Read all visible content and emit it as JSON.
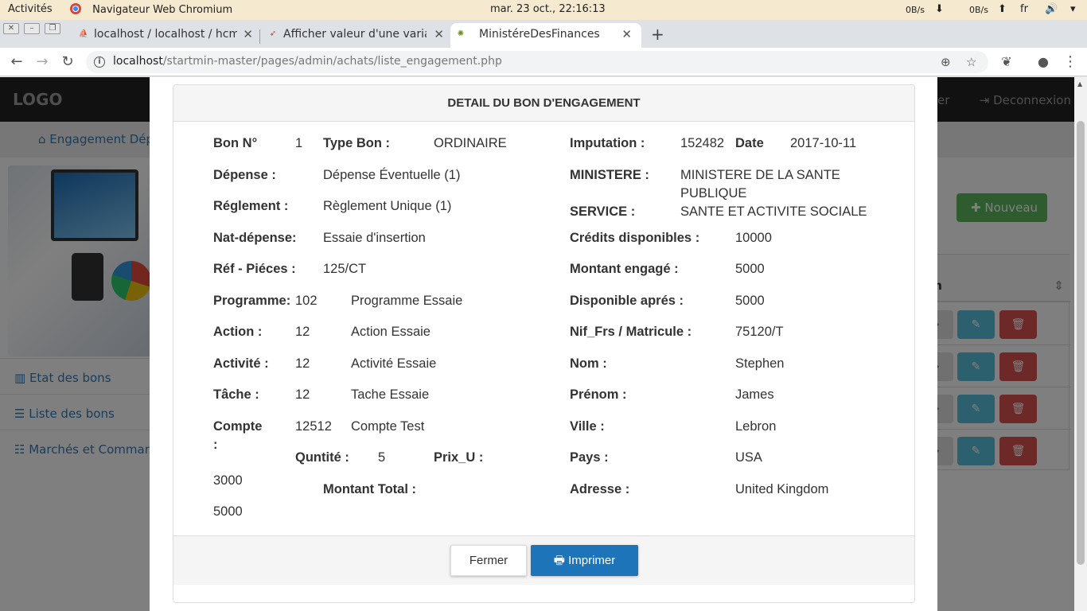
{
  "system_bar": {
    "activities": "Activités",
    "app_name": "Navigateur Web Chromium",
    "datetime": "mar. 23 oct., 22:16:13",
    "net_down": "0B/s",
    "net_up": "0B/s",
    "lang": "fr",
    "volume_icon": "speaker-icon",
    "down_arrow": "⬇",
    "up_arrow": "⬆",
    "menu_arrow": "▾"
  },
  "browser": {
    "tabs": [
      {
        "title": "localhost / localhost / hcm",
        "icon": "phpmyadmin-icon",
        "active": false
      },
      {
        "title": "Afficher valeur d'une variable",
        "icon": "stack-icon",
        "active": false
      },
      {
        "title": "MinistéreDesFinances",
        "icon": "emblem-icon",
        "active": true
      }
    ],
    "new_tab": "+",
    "close_glyph": "✕",
    "url_host": "localhost",
    "url_path": "/startmin-master/pages/admin/achats/liste_engagement.php",
    "info_glyph": "i",
    "zoom_glyph": "⊕",
    "star_glyph": "☆",
    "ext_glyph": "❦",
    "account_glyph": "●",
    "menu_glyph": "⋮",
    "back_glyph": "←",
    "forward_glyph": "→",
    "reload_glyph": "↻"
  },
  "app": {
    "logo": "LOGO",
    "logout": "Deconnexion",
    "logout_partial": "er",
    "breadcrumb": "Engagement Dép",
    "sidebar": [
      {
        "label": "Etat des bons",
        "icon": "bar-chart-icon"
      },
      {
        "label": "Liste des bons",
        "icon": "list-icon"
      },
      {
        "label": "Marchés et Commandes",
        "icon": "list-alt-icon"
      }
    ],
    "new_button": "Nouveau",
    "table_header": "on",
    "row_icons": {
      "view": "›",
      "edit": "✎",
      "delete": "🗑"
    }
  },
  "modal": {
    "title": "DETAIL DU BON D'ENGAGEMENT",
    "left": {
      "bon_no_label": "Bon N°",
      "bon_no": "1",
      "type_bon_label": "Type Bon :",
      "type_bon": "ORDINAIRE",
      "depense_label": "Dépense :",
      "depense": "Dépense Éventuelle (1)",
      "reglement_label": "Réglement :",
      "reglement": "Règlement Unique (1)",
      "nat_depense_label": "Nat-dépense:",
      "nat_depense": "Essaie d'insertion",
      "ref_pieces_label": "Réf - Piéces :",
      "ref_pieces": "125/CT",
      "programme_label": "Programme:",
      "programme_code": "102",
      "programme_name": "Programme Essaie",
      "action_label": "Action :",
      "action_code": "12",
      "action_name": "Action Essaie",
      "activite_label": "Activité :",
      "activite_code": "12",
      "activite_name": "Activité Essaie",
      "tache_label": "Tâche :",
      "tache_code": "12",
      "tache_name": "Tache Essaie",
      "compte_label_1": "Compte",
      "compte_label_2": ":",
      "compte_code": "12512",
      "compte_name": "Compte Test",
      "quantite_label": "Quntité :",
      "quantite": "5",
      "prix_u_label": "Prix_U :",
      "prix_u": "3000",
      "montant_total_label": "Montant Total :",
      "montant_total": "5000"
    },
    "right": {
      "imputation_label": "Imputation :",
      "imputation": "152482",
      "date_label": "Date",
      "date": "2017-10-11",
      "ministere_label": "MINISTERE :",
      "ministere_line1": "MINISTERE DE LA SANTE",
      "ministere_line2": "PUBLIQUE",
      "service_label": "SERVICE :",
      "service": "SANTE ET ACTIVITE SOCIALE",
      "credits_label": "Crédits disponibles :",
      "credits": "10000",
      "montant_engage_label": "Montant engagé :",
      "montant_engage": "5000",
      "disponible_label": "Disponible aprés :",
      "disponible": "5000",
      "nif_label": "Nif_Frs / Matricule :",
      "nif": "75120/T",
      "nom_label": "Nom :",
      "nom": "Stephen",
      "prenom_label": "Prénom :",
      "prenom": "James",
      "ville_label": "Ville :",
      "ville": "Lebron",
      "pays_label": "Pays :",
      "pays": "USA",
      "adresse_label": "Adresse :",
      "adresse": "United Kingdom"
    },
    "buttons": {
      "close": "Fermer",
      "print": "Imprimer",
      "print_icon": "printer-icon"
    }
  }
}
